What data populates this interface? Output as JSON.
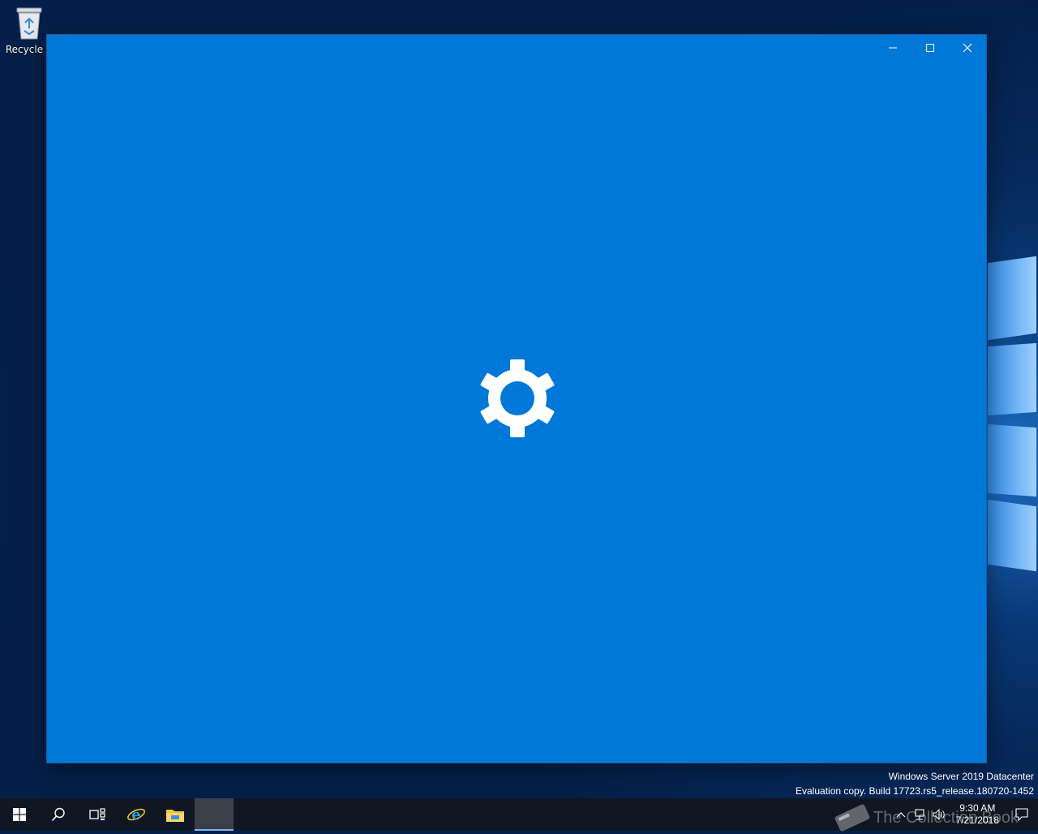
{
  "desktop": {
    "recycle_bin_label": "Recycle B"
  },
  "window": {
    "background_color": "#0078d7",
    "state": "loading",
    "center_icon": "gear-icon",
    "controls": {
      "minimize_icon": "minimize-icon",
      "maximize_icon": "maximize-icon",
      "close_icon": "close-icon"
    }
  },
  "watermark": {
    "line1": "Windows Server 2019 Datacenter",
    "line2": "Evaluation copy. Build 17723.rs5_release.180720-1452"
  },
  "taskbar": {
    "items": [
      "start-icon",
      "search-icon",
      "task-view-icon",
      "internet-explorer-icon",
      "file-explorer-icon",
      "active-app"
    ],
    "tray_icons": [
      "show-hidden-icons-chevron",
      "network-icon",
      "volume-icon"
    ],
    "clock": {
      "time": "9:30 AM",
      "date": "7/21/2018"
    },
    "notification_icon": "action-center-icon"
  },
  "overlay_logo_text": "The Collection Book"
}
